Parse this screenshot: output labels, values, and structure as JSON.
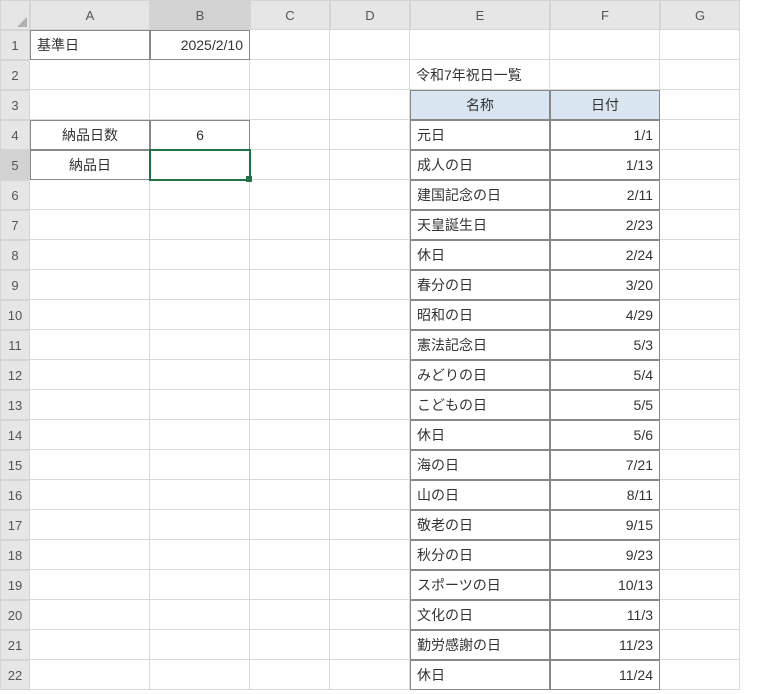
{
  "columns": [
    "A",
    "B",
    "C",
    "D",
    "E",
    "F",
    "G"
  ],
  "rowCount": 22,
  "activeCell": "B5",
  "cells": {
    "A1": {
      "v": "基準日",
      "align": "left",
      "boxed": true
    },
    "B1": {
      "v": "2025/2/10",
      "align": "right",
      "boxed": true
    },
    "A4": {
      "v": "納品日数",
      "align": "center",
      "boxed": true
    },
    "B4": {
      "v": "6",
      "align": "center",
      "boxed": true
    },
    "A5": {
      "v": "納品日",
      "align": "center",
      "boxed": true
    },
    "B5": {
      "v": "",
      "align": "center",
      "boxed": true,
      "active": true
    },
    "E2": {
      "v": "令和7年祝日一覧",
      "align": "left"
    },
    "E3": {
      "v": "名称",
      "align": "center",
      "tblhdr": true
    },
    "F3": {
      "v": "日付",
      "align": "center",
      "tblhdr": true
    }
  },
  "holidays": [
    {
      "name": "元日",
      "date": "1/1"
    },
    {
      "name": "成人の日",
      "date": "1/13"
    },
    {
      "name": "建国記念の日",
      "date": "2/11"
    },
    {
      "name": "天皇誕生日",
      "date": "2/23"
    },
    {
      "name": "休日",
      "date": "2/24"
    },
    {
      "name": "春分の日",
      "date": "3/20"
    },
    {
      "name": "昭和の日",
      "date": "4/29"
    },
    {
      "name": "憲法記念日",
      "date": "5/3"
    },
    {
      "name": "みどりの日",
      "date": "5/4"
    },
    {
      "name": "こどもの日",
      "date": "5/5"
    },
    {
      "name": "休日",
      "date": "5/6"
    },
    {
      "name": "海の日",
      "date": "7/21"
    },
    {
      "name": "山の日",
      "date": "8/11"
    },
    {
      "name": "敬老の日",
      "date": "9/15"
    },
    {
      "name": "秋分の日",
      "date": "9/23"
    },
    {
      "name": "スポーツの日",
      "date": "10/13"
    },
    {
      "name": "文化の日",
      "date": "11/3"
    },
    {
      "name": "勤労感謝の日",
      "date": "11/23"
    },
    {
      "name": "休日",
      "date": "11/24"
    }
  ]
}
